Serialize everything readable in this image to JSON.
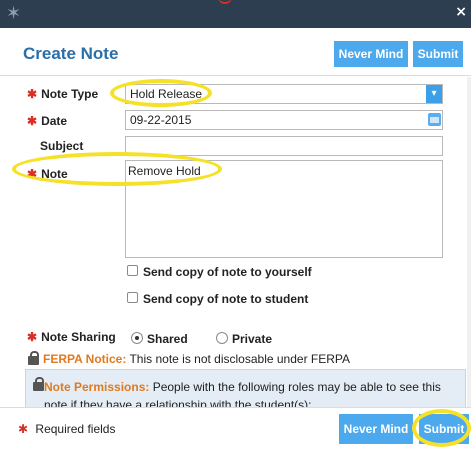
{
  "window": {
    "logo_icon": "star-logo-icon",
    "close_label": "×"
  },
  "header": {
    "title": "Create Note",
    "never_mind": "Never Mind",
    "submit": "Submit"
  },
  "form": {
    "note_type": {
      "label": "Note Type",
      "value": "Hold Release"
    },
    "date": {
      "label": "Date",
      "value": "09-22-2015"
    },
    "subject": {
      "label": "Subject",
      "value": ""
    },
    "note": {
      "label": "Note",
      "value": "Remove Hold"
    },
    "copy_self": "Send copy of note to yourself",
    "copy_student": "Send copy of note to student",
    "sharing": {
      "label": "Note Sharing",
      "shared": "Shared",
      "private": "Private",
      "selected": "Shared"
    },
    "ferpa": {
      "title": "FERPA Notice:",
      "text": " This note is not disclosable under FERPA"
    },
    "permissions": {
      "title": "Note Permissions:",
      "text": " People with the following roles may be able to see this note if they have a relationship with the student(s):"
    }
  },
  "footer": {
    "required_note": "Required fields",
    "never_mind": "Never Mind",
    "submit": "Submit"
  },
  "colors": {
    "accent": "#4ca9ee",
    "title": "#2a6fa8",
    "required": "#d93025",
    "highlight": "#f5e128",
    "warning": "#e07a1f"
  }
}
